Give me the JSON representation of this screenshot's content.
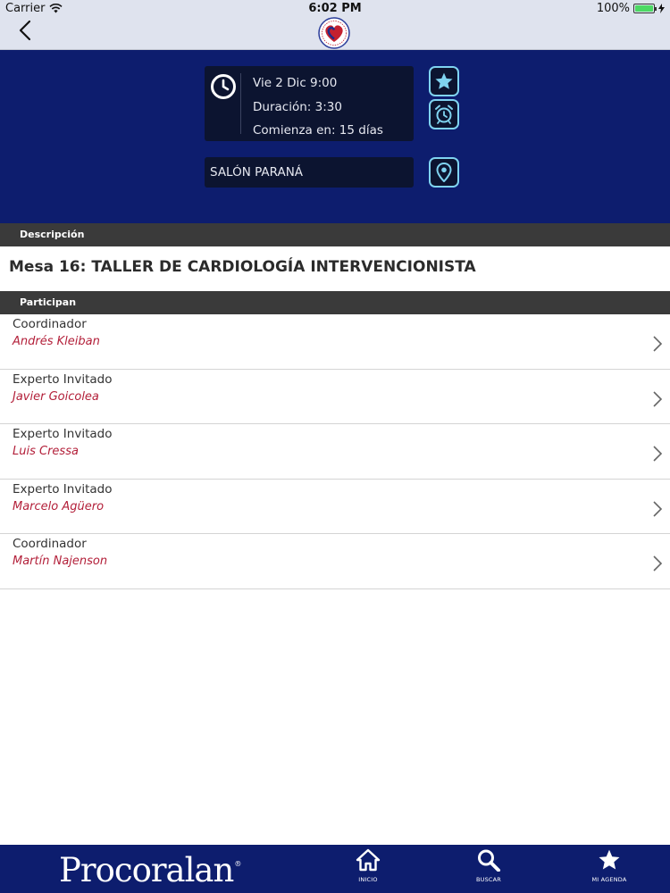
{
  "status_bar": {
    "carrier": "Carrier",
    "time": "6:02 PM",
    "battery": "100%"
  },
  "event": {
    "date": "Vie 2  Dic  9:00",
    "duration": "Duración: 3:30",
    "starts_in": "Comienza en: 15 días",
    "room": "SALÓN PARANÁ"
  },
  "sections": {
    "description": "Descripción",
    "participants": "Participan"
  },
  "title": "Mesa 16: TALLER DE CARDIOLOGÍA INTERVENCIONISTA",
  "participants": [
    {
      "role": "Coordinador",
      "name": "Andrés Kleiban"
    },
    {
      "role": "Experto Invitado",
      "name": "Javier Goicolea"
    },
    {
      "role": "Experto Invitado",
      "name": "Luis Cressa"
    },
    {
      "role": "Experto Invitado",
      "name": "Marcelo Agüero"
    },
    {
      "role": "Coordinador",
      "name": "Martín Najenson"
    }
  ],
  "tabbar": {
    "brand": "Procoralan",
    "brand_mark": "®",
    "tabs": [
      {
        "label": "INICIO",
        "icon": "home-icon"
      },
      {
        "label": "BUSCAR",
        "icon": "search-icon"
      },
      {
        "label": "MI AGENDA",
        "icon": "star-icon"
      }
    ]
  },
  "colors": {
    "primary_navy": "#0d1d6e",
    "accent_cyan": "#7fd3f0",
    "name_red": "#b3203a",
    "section_header": "#3a3a3a"
  }
}
